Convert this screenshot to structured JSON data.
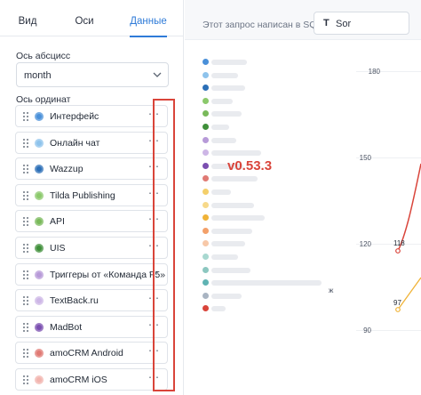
{
  "tabs": [
    {
      "label": "Вид"
    },
    {
      "label": "Оси"
    },
    {
      "label": "Данные"
    }
  ],
  "x_axis": {
    "label": "Ось абсцисс",
    "value": "month"
  },
  "y_axis": {
    "label": "Ось ординат",
    "items": [
      {
        "name": "Интерфейс",
        "color": "#4a90d9"
      },
      {
        "name": "Онлайн чат",
        "color": "#8ec3ec"
      },
      {
        "name": "Wazzup",
        "color": "#2c6fb7"
      },
      {
        "name": "Tilda Publishing",
        "color": "#8bc96b"
      },
      {
        "name": "API",
        "color": "#79b95a"
      },
      {
        "name": "UIS",
        "color": "#3f8f3a"
      },
      {
        "name": "Триггеры от «Команда F5»",
        "color": "#b79ad8"
      },
      {
        "name": "TextBack.ru",
        "color": "#cdb6e6"
      },
      {
        "name": "MadBot",
        "color": "#7b4fb0"
      },
      {
        "name": "amoCRM Android",
        "color": "#e07a74"
      },
      {
        "name": "amoCRM iOS",
        "color": "#f2b4ae"
      }
    ]
  },
  "toolbar": {
    "sql_note": "Этот запрос написан в SQL.",
    "sort_label": "Sor"
  },
  "version": "v0.53.3",
  "legend_colors": [
    "#4a90d9",
    "#8ec3ec",
    "#2c6fb7",
    "#8bc96b",
    "#79b95a",
    "#3f8f3a",
    "#b79ad8",
    "#cdb6e6",
    "#7b4fb0",
    "#e07a74",
    "#f4cf6a",
    "#f7d98a",
    "#f0b338",
    "#f3a06a",
    "#f7c8a8",
    "#a8d8d0",
    "#8cc7c0",
    "#5fb3b3",
    "#a9b4c2",
    "#d9443a"
  ],
  "legend_partial_text": "ж",
  "chart_data": {
    "type": "line",
    "yticks": [
      180,
      150,
      120,
      90
    ],
    "series": [
      {
        "values": [
          118
        ],
        "color": "#d9443a",
        "labels": [
          "118"
        ]
      },
      {
        "values": [
          97
        ],
        "color": "#f0b338",
        "labels": [
          "97"
        ]
      }
    ]
  }
}
